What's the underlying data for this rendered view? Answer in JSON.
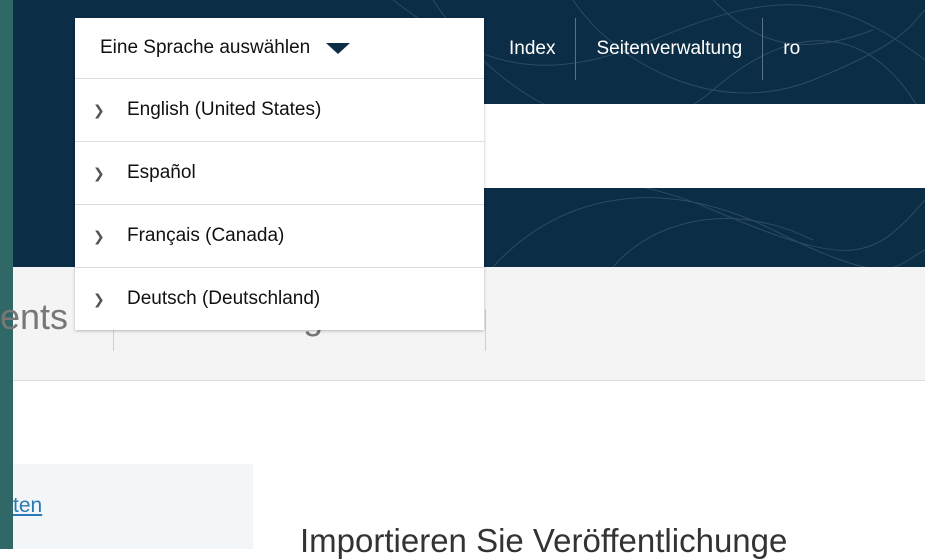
{
  "header": {
    "nav_items": [
      "Index",
      "Seitenverwaltung",
      "ro"
    ]
  },
  "language_menu": {
    "toggle_label": "Eine Sprache auswählen",
    "options": [
      "English (United States)",
      "Español",
      "Français (Canada)",
      "Deutsch (Deutschland)"
    ]
  },
  "tabs": {
    "left_fragment": "ents",
    "second": "Forschungsnetz"
  },
  "sidebar": {
    "link_fragment": "ten"
  },
  "main": {
    "heading_fragment": "Importieren Sie Veröffentlichunge"
  },
  "colors": {
    "header_bg": "#0c2d46",
    "link": "#2a7ab3",
    "edge": "#2f6866"
  }
}
